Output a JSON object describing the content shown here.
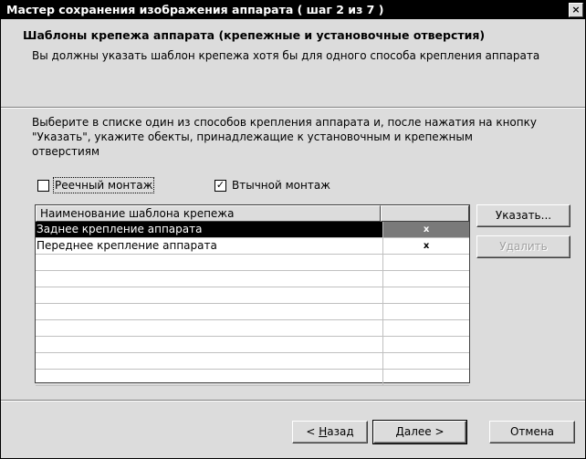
{
  "window": {
    "title": "Мастер сохранения изображения аппарата ( шаг 2 из 7 )",
    "close_glyph": "×"
  },
  "header": {
    "title": "Шаблоны крепежа аппарата (крепежные и установочные отверстия)",
    "subtitle": "Вы должны указать шаблон крепежа хотя бы для одного способа крепления аппарата"
  },
  "instructions": "Выберите в списке один из способов крепления аппарата и, после нажатия на кнопку \"Указать\", укажите обекты, принадлежащие к установочным и крепежным отверстиям",
  "mounting": {
    "rail": {
      "label": "Реечный монтаж",
      "checked": false
    },
    "manual": {
      "label": "Втычной монтаж",
      "checked": true,
      "check_glyph": "✓"
    }
  },
  "table": {
    "columns": [
      "Наименование шаблона крепежа",
      ""
    ],
    "rows": [
      {
        "name": "Заднее крепление аппарата",
        "mark": "x",
        "selected": true
      },
      {
        "name": "Переднее крепление аппарата",
        "mark": "x",
        "selected": false
      }
    ],
    "empty_rows": 8
  },
  "side_buttons": {
    "specify": "Указать...",
    "delete": "Удалить"
  },
  "footer": {
    "back_prefix": "< ",
    "back_mnemonic": "Н",
    "back_rest": "азад",
    "next": "Далее >",
    "cancel": "Отмена"
  }
}
